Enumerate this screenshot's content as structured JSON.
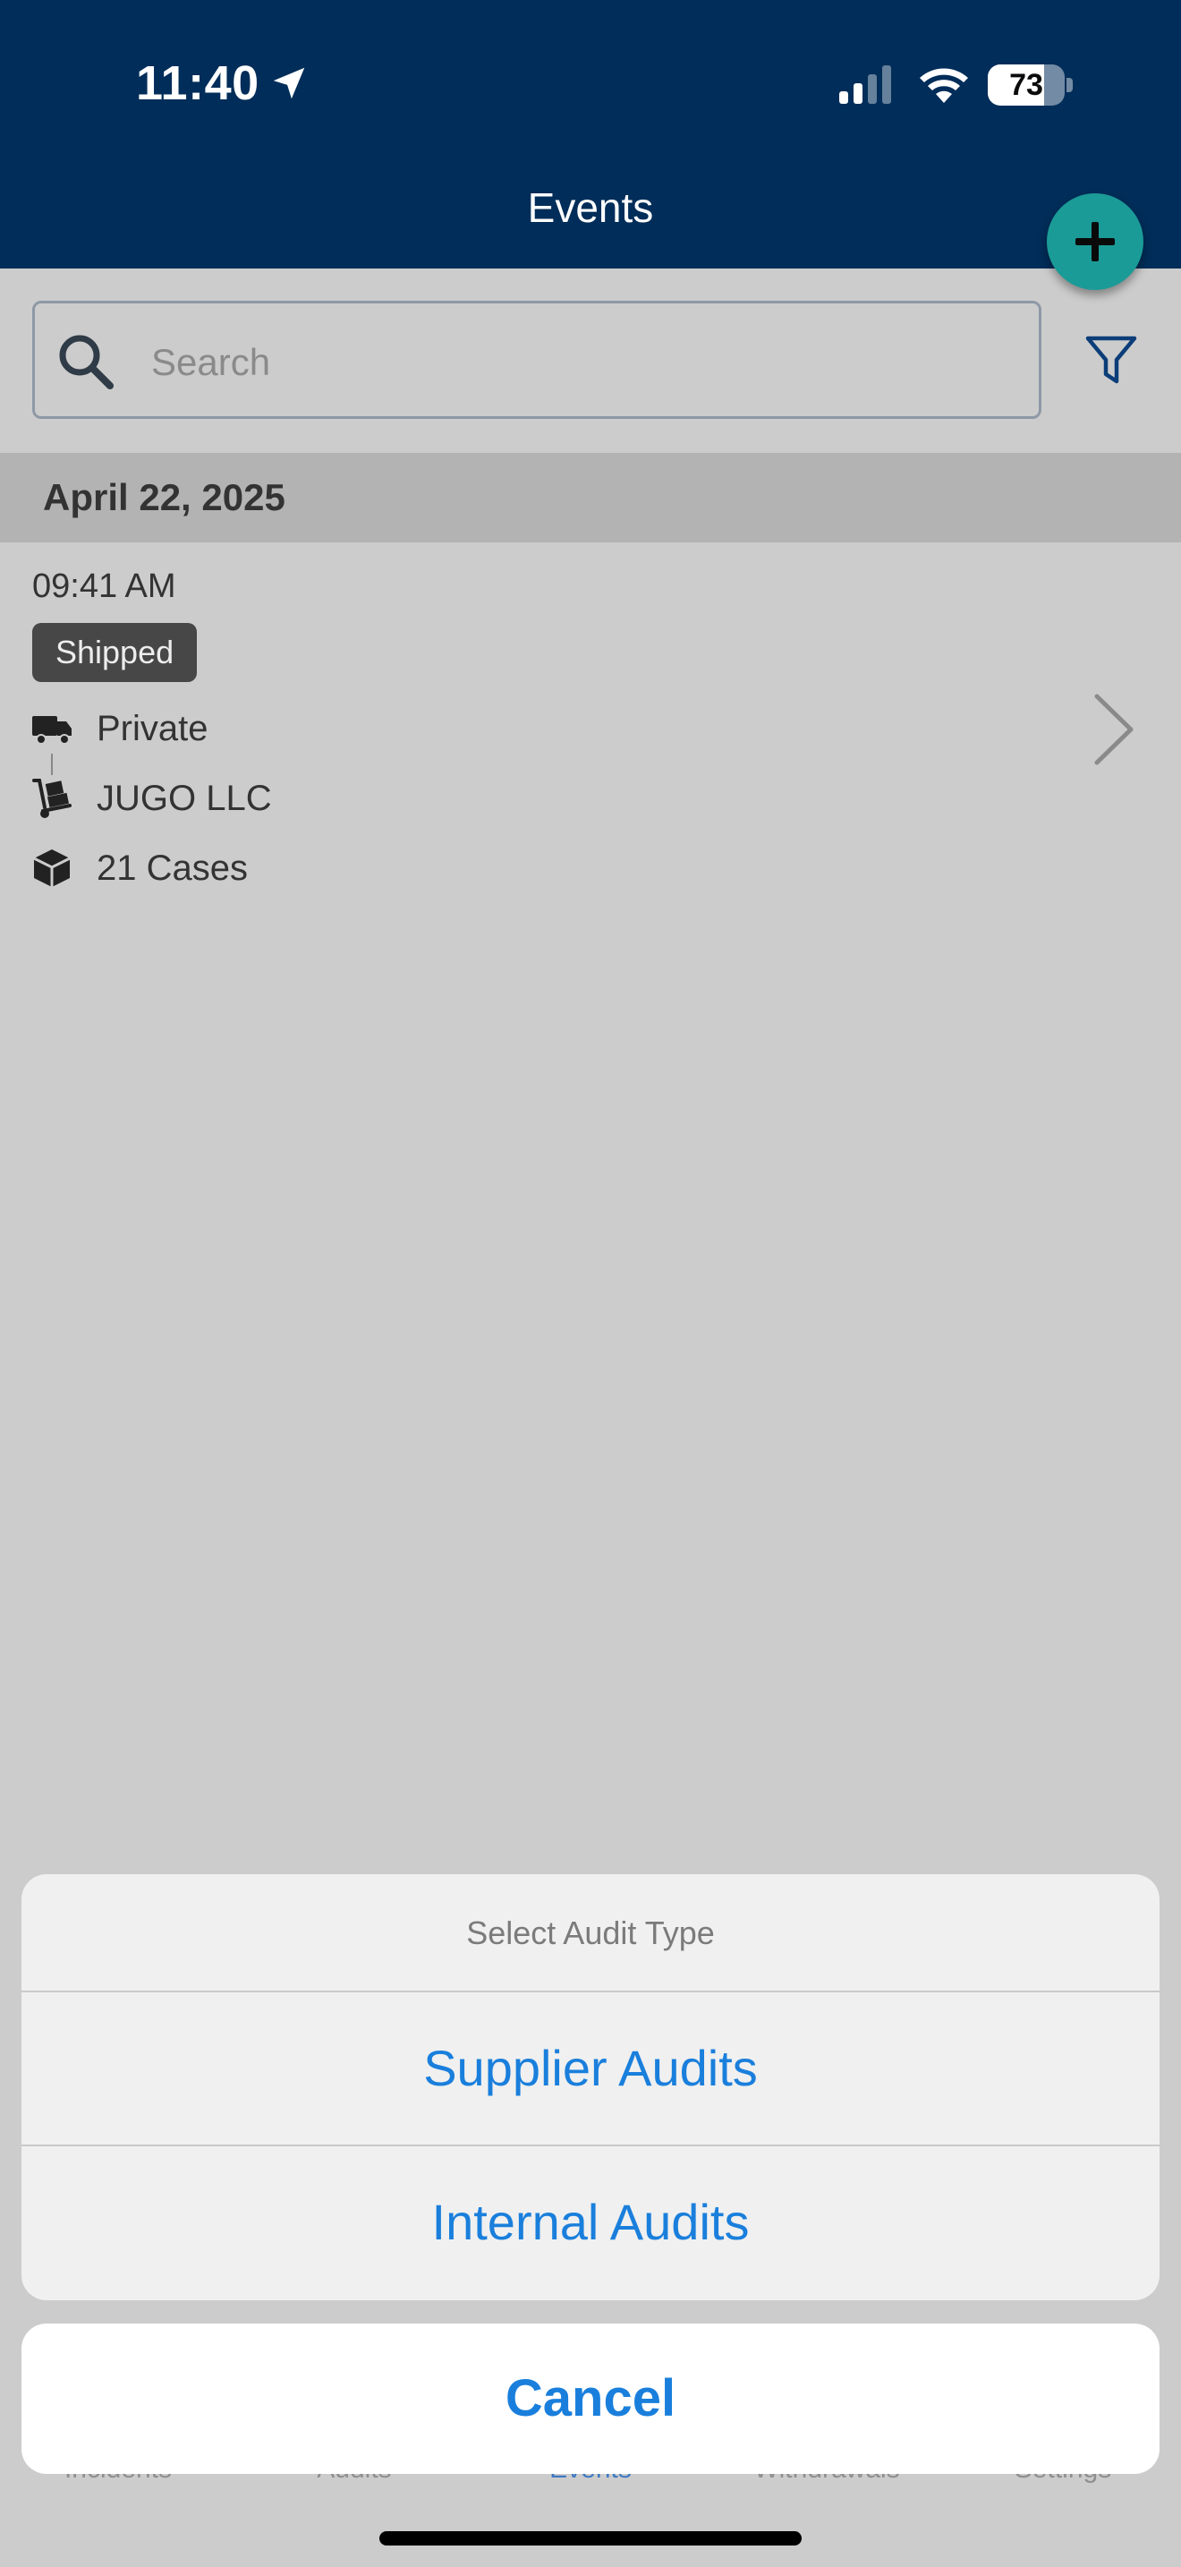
{
  "status_bar": {
    "time": "11:40",
    "battery": "73",
    "battery_level": 0.73
  },
  "header": {
    "title": "Events"
  },
  "search": {
    "placeholder": "Search"
  },
  "events": {
    "section_date": "April 22, 2025",
    "item": {
      "time": "09:41 AM",
      "status": "Shipped",
      "carrier": "Private",
      "supplier": "JUGO LLC",
      "quantity": "21 Cases"
    }
  },
  "action_sheet": {
    "title": "Select Audit Type",
    "options": [
      "Supplier Audits",
      "Internal Audits"
    ],
    "cancel": "Cancel"
  },
  "tab_bar": {
    "tabs": [
      "Incidents",
      "Audits",
      "Events",
      "Withdrawals",
      "Settings"
    ],
    "active_index": 2
  },
  "colors": {
    "header": "#002d59",
    "fab": "#1b9b97",
    "accent": "#1a7fdc"
  }
}
